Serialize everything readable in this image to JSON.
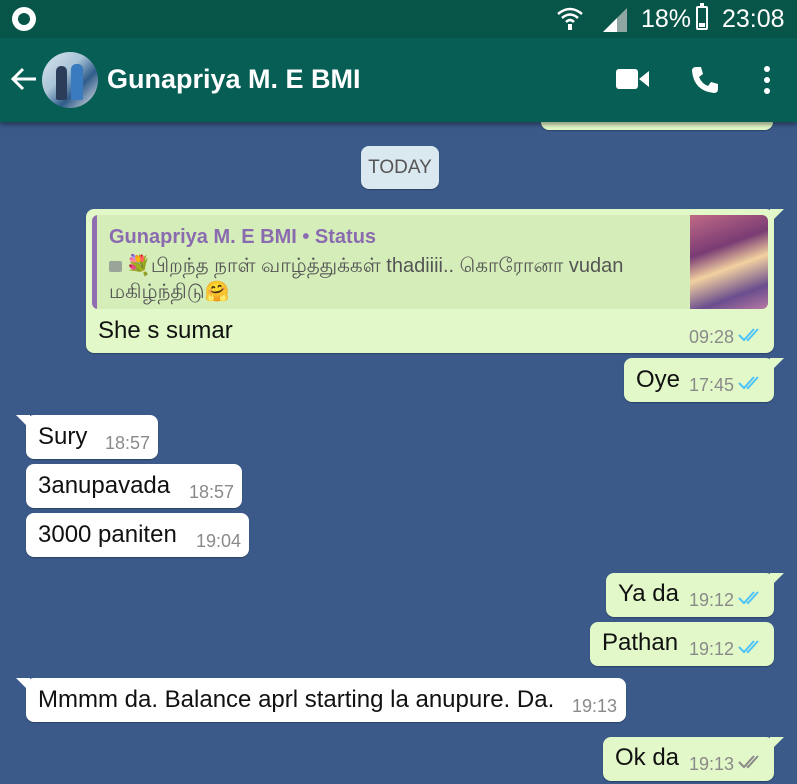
{
  "status_bar": {
    "battery": "18%",
    "time": "23:08"
  },
  "header": {
    "contact_name": "Gunapriya M. E BMI"
  },
  "date_chip": "TODAY",
  "quoted_reply": {
    "author_line": "Gunapriya M. E BMI • Status",
    "status_text": "💐பிறந்த நாள் வாழ்த்துக்கள் thadiiii.. கொரோனா vudan மகிழ்ந்திடு🤗"
  },
  "messages": [
    {
      "direction": "out",
      "text": "She s sumar",
      "time": "09:28",
      "ticks": "read"
    },
    {
      "direction": "out",
      "text": "Oye",
      "time": "17:45",
      "ticks": "read"
    },
    {
      "direction": "in",
      "text": "Sury",
      "time": "18:57"
    },
    {
      "direction": "in",
      "text": "3anupavada",
      "time": "18:57"
    },
    {
      "direction": "in",
      "text": "3000 paniten",
      "time": "19:04"
    },
    {
      "direction": "out",
      "text": "Ya da",
      "time": "19:12",
      "ticks": "read"
    },
    {
      "direction": "out",
      "text": "Pathan",
      "time": "19:12",
      "ticks": "read"
    },
    {
      "direction": "in",
      "text": "Mmmm da. Balance aprl starting la anupure. Da.",
      "time": "19:13"
    },
    {
      "direction": "out",
      "text": "Ok da",
      "time": "19:13",
      "ticks": "delivered"
    }
  ],
  "colors": {
    "header": "#075e54",
    "chat_background": "#3b5a8a",
    "outgoing_bubble": "#e2f8c8",
    "incoming_bubble": "#ffffff",
    "read_ticks": "#4fc3f7",
    "delivered_ticks": "#8a8a8a"
  },
  "icons": [
    "back-arrow-icon",
    "video-call-icon",
    "phone-icon",
    "more-options-icon",
    "wifi-icon",
    "signal-icon",
    "battery-icon",
    "double-check-icon"
  ]
}
